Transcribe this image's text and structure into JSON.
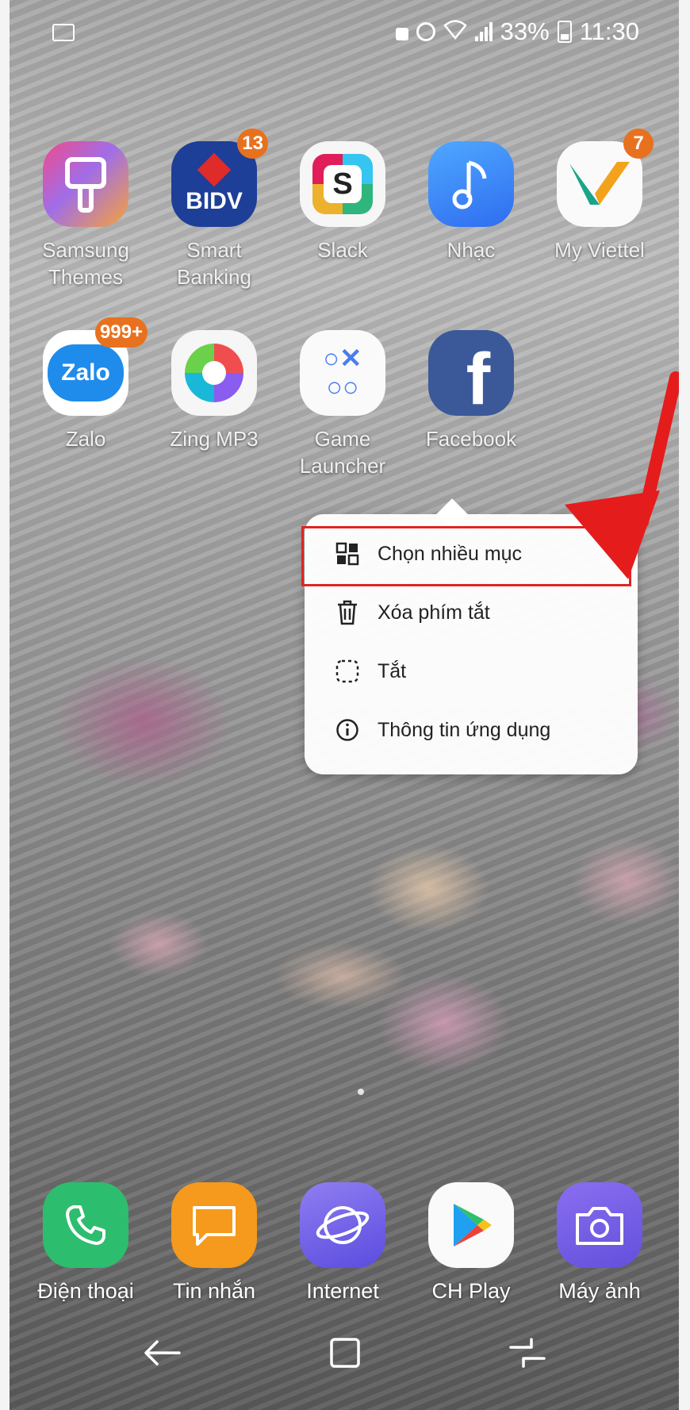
{
  "status_bar": {
    "battery_percent": "33%",
    "time": "11:30",
    "icons": [
      "image-notification-icon",
      "lock-icon",
      "alarm-icon",
      "wifi-icon",
      "signal-icon",
      "battery-icon"
    ]
  },
  "apps_row1": [
    {
      "label": "Samsung\nThemes",
      "icon": "samsung-themes-icon"
    },
    {
      "label": "Smart\nBanking",
      "icon": "bidv-icon",
      "icon_text": "BIDV",
      "badge": "13"
    },
    {
      "label": "Slack",
      "icon": "slack-icon",
      "icon_text": "S"
    },
    {
      "label": "Nhạc",
      "icon": "music-note-icon"
    },
    {
      "label": "My Viettel",
      "icon": "viettel-icon",
      "badge": "7"
    }
  ],
  "apps_row2": [
    {
      "label": "Zalo",
      "icon": "zalo-icon",
      "icon_text": "Zalo",
      "badge": "999+"
    },
    {
      "label": "Zing MP3",
      "icon": "zing-mp3-icon"
    },
    {
      "label": "Game\nLauncher",
      "icon": "game-launcher-icon",
      "icon_text": "○✕\n○○"
    },
    {
      "label": "Facebook",
      "icon": "facebook-icon",
      "icon_text": "f"
    }
  ],
  "context_menu": {
    "items": [
      {
        "label": "Chọn nhiều mục",
        "icon": "select-multiple-icon"
      },
      {
        "label": "Xóa phím tắt",
        "icon": "trash-icon"
      },
      {
        "label": "Tắt",
        "icon": "dashed-square-icon"
      },
      {
        "label": "Thông tin ứng dụng",
        "icon": "info-icon"
      }
    ],
    "highlighted_item": "Chọn nhiều mục"
  },
  "dock": [
    {
      "label": "Điện thoại",
      "icon": "phone-icon"
    },
    {
      "label": "Tin nhắn",
      "icon": "messages-icon"
    },
    {
      "label": "Internet",
      "icon": "internet-icon"
    },
    {
      "label": "CH Play",
      "icon": "play-store-icon"
    },
    {
      "label": "Máy ảnh",
      "icon": "camera-icon"
    }
  ],
  "nav_bar": [
    "back-icon",
    "home-icon",
    "recents-icon"
  ],
  "colors": {
    "highlight_border": "#e02424",
    "badge": "#e8711f",
    "arrow": "#e51c1c"
  }
}
